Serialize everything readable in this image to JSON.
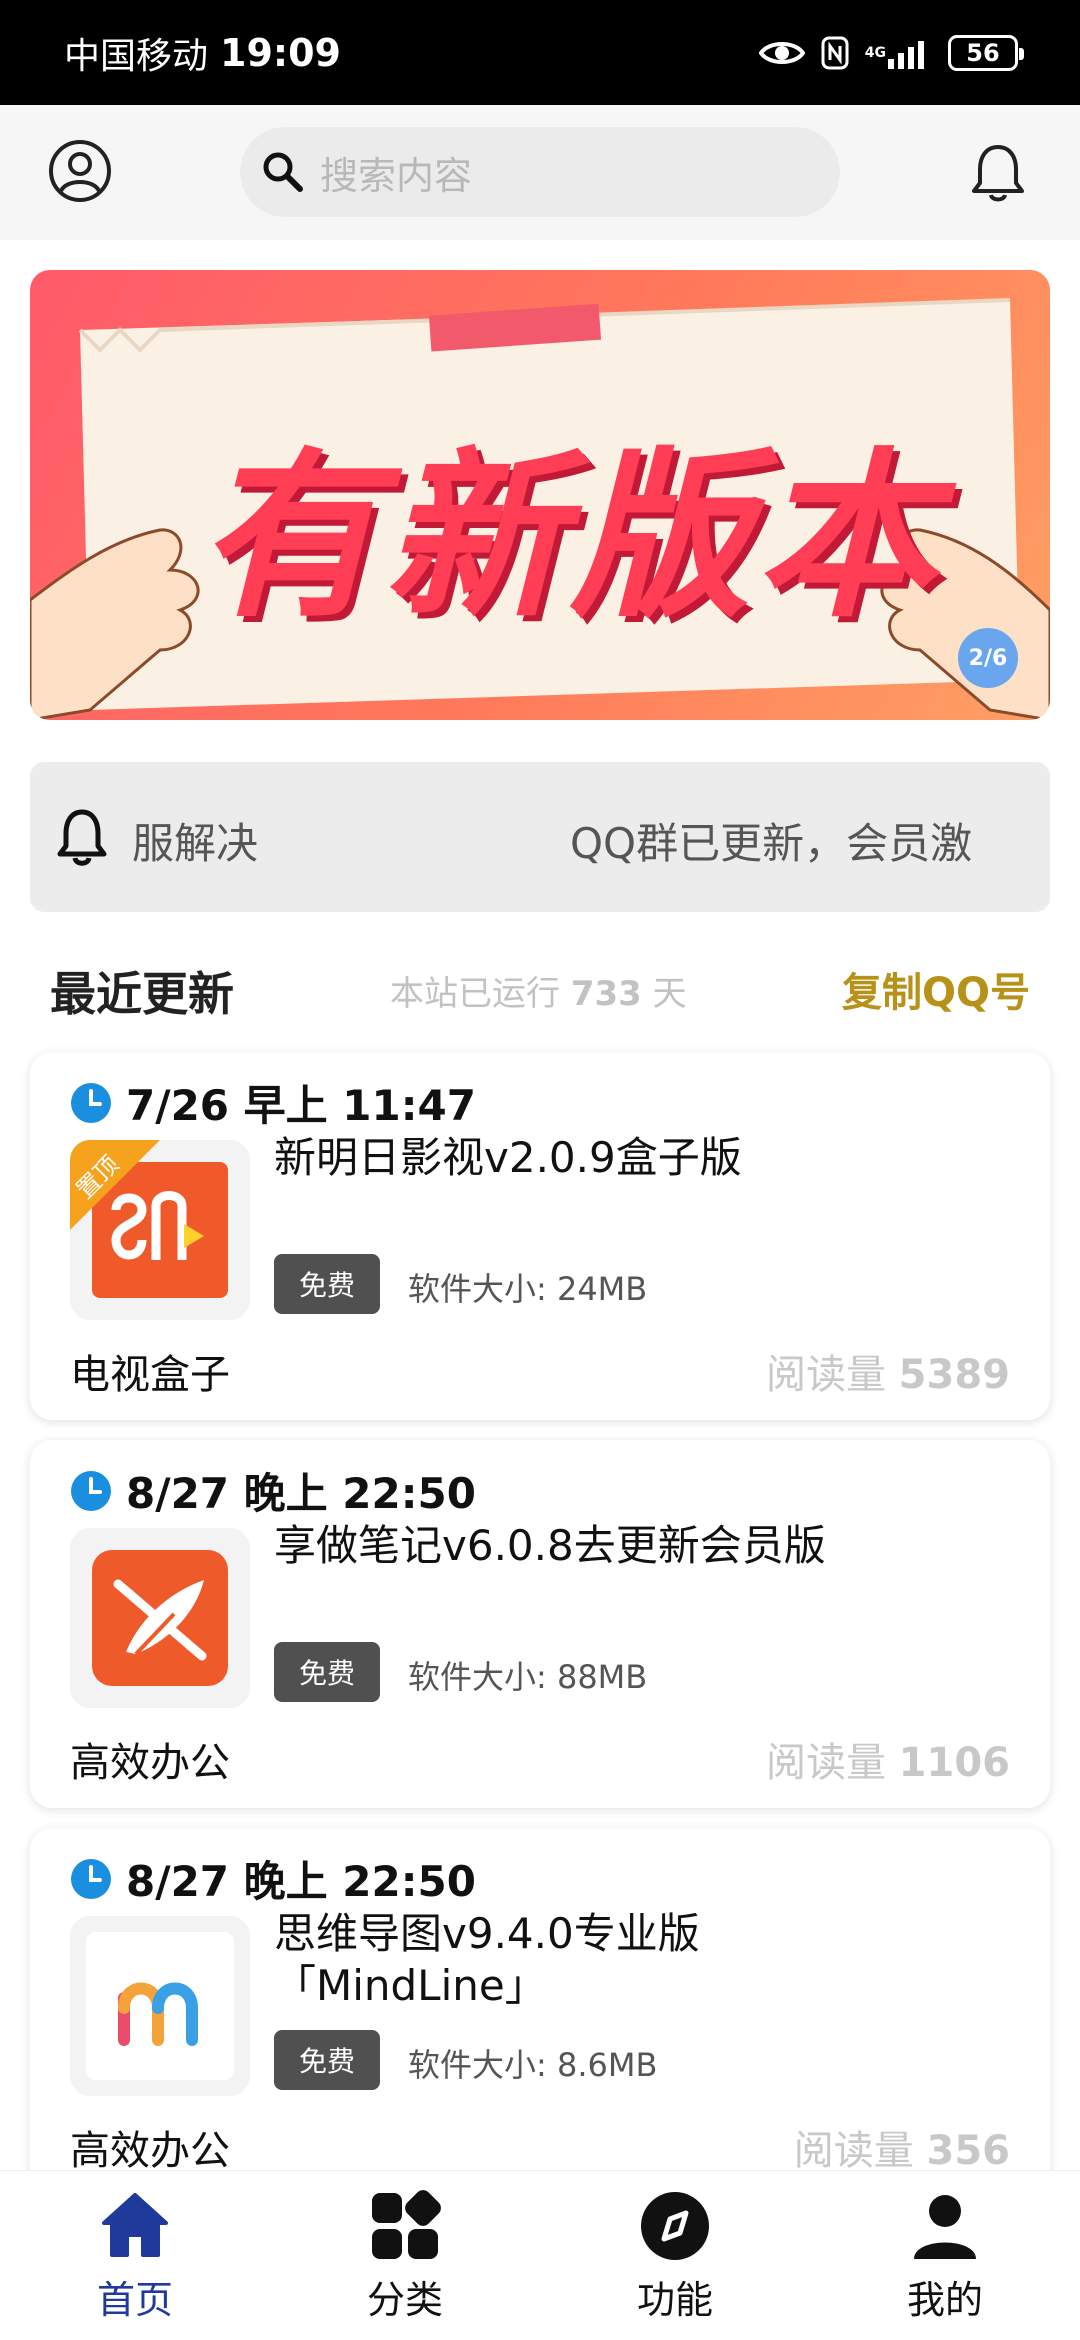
{
  "status_bar": {
    "carrier": "中国移动",
    "time": "19:09",
    "network": "4G",
    "battery": "56"
  },
  "header": {
    "search_placeholder": "搜索内容"
  },
  "banner": {
    "title": "有新版本",
    "page_indicator": "2/6"
  },
  "notice": {
    "messages": [
      "服解决",
      "QQ群已更新，会员激"
    ]
  },
  "section": {
    "title": "最近更新",
    "uptime_prefix": "本站已运行",
    "uptime_days": "733",
    "uptime_suffix": "天",
    "copy_qq": "复制QQ号"
  },
  "cards": [
    {
      "date": "7/26 早上 11:47",
      "app_name": "新明日影视v2.0.9盒子版",
      "free": "免费",
      "size": "软件大小: 24MB",
      "category": "电视盒子",
      "reads_label": "阅读量",
      "reads": "5389",
      "pinned": "置顶"
    },
    {
      "date": "8/27 晚上 22:50",
      "app_name": "享做笔记v6.0.8去更新会员版",
      "free": "免费",
      "size": "软件大小: 88MB",
      "category": "高效办公",
      "reads_label": "阅读量",
      "reads": "1106"
    },
    {
      "date": "8/27 晚上 22:50",
      "app_name": "思维导图v9.4.0专业版「MindLine」",
      "free": "免费",
      "size": "软件大小: 8.6MB",
      "category": "高效办公",
      "reads_label": "阅读量",
      "reads": "356"
    }
  ],
  "nav": {
    "items": [
      {
        "label": "首页",
        "icon": "home-icon",
        "active": true
      },
      {
        "label": "分类",
        "icon": "category-icon"
      },
      {
        "label": "功能",
        "icon": "compass-icon"
      },
      {
        "label": "我的",
        "icon": "person-icon"
      }
    ]
  },
  "colors": {
    "accent": "#1f3a9a",
    "gold": "#b89218",
    "banner_red": "#ff3d55"
  }
}
